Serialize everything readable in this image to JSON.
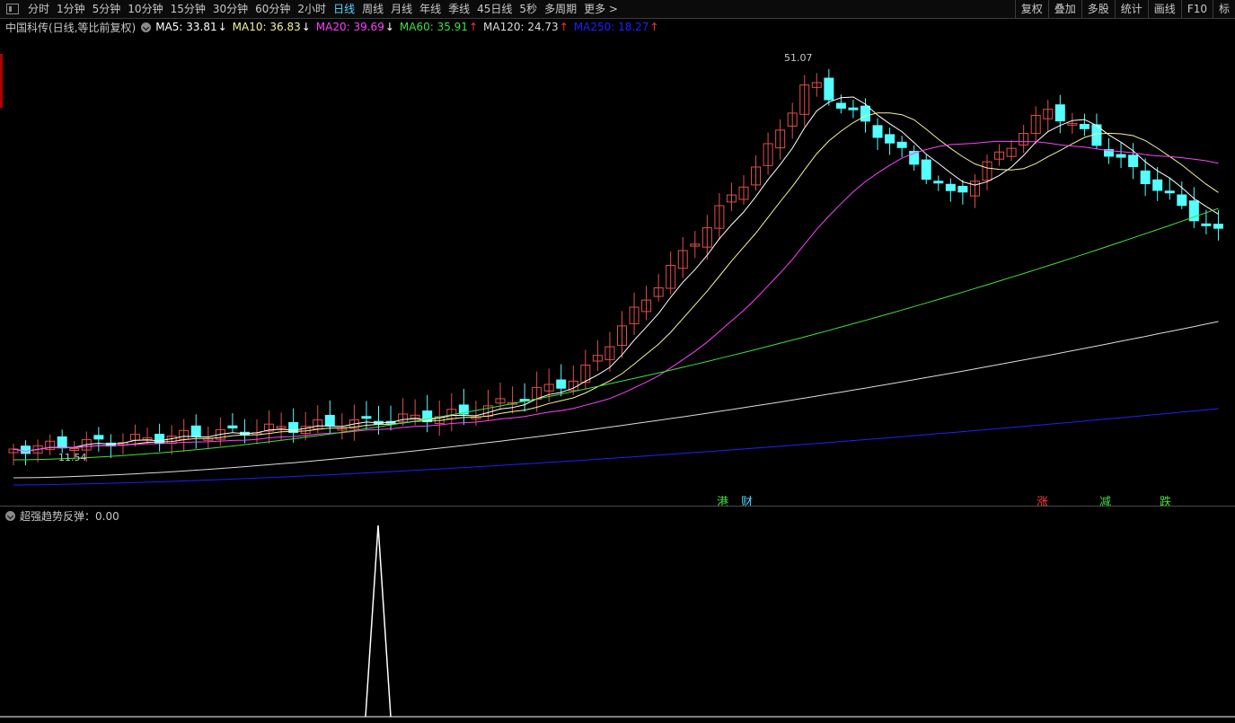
{
  "toolbar": {
    "timeframes": [
      "分时",
      "1分钟",
      "5分钟",
      "10分钟",
      "15分钟",
      "30分钟",
      "60分钟",
      "2小时",
      "日线",
      "周线",
      "月线",
      "年线",
      "季线",
      "45日线",
      "5秒",
      "多周期",
      "更多 >"
    ],
    "active": "日线",
    "right_buttons": [
      "复权",
      "叠加",
      "多股",
      "统计",
      "画线",
      "F10",
      "标"
    ]
  },
  "chart": {
    "title": "中国科传(日线,等比前复权)",
    "ma": [
      {
        "label": "MA5: 33.81",
        "arrow": "↓",
        "color": "#ffffff",
        "arrow_color": "#ffffff"
      },
      {
        "label": "MA10: 36.83",
        "arrow": "↓",
        "color": "#f5f39a",
        "arrow_color": "#ffffff"
      },
      {
        "label": "MA20: 39.69",
        "arrow": "↓",
        "color": "#ff40ff",
        "arrow_color": "#ffffff"
      },
      {
        "label": "MA60: 35.91",
        "arrow": "↑",
        "color": "#40e040",
        "arrow_color": "#ff3030"
      },
      {
        "label": "MA120: 24.73",
        "arrow": "↑",
        "color": "#dcdcdc",
        "arrow_color": "#ff3030"
      },
      {
        "label": "MA250: 18.27",
        "arrow": "↑",
        "color": "#2020ff",
        "arrow_color": "#ff3030"
      }
    ],
    "high_label": "51.07",
    "low_label": "11.54",
    "tags": [
      {
        "text": "港",
        "color": "#40e040"
      },
      {
        "text": "财",
        "color": "#57d7ff"
      },
      {
        "text": "涨",
        "color": "#ff4040"
      },
      {
        "text": "减",
        "color": "#40e040"
      },
      {
        "text": "跌",
        "color": "#40e040"
      }
    ],
    "colors": {
      "up": "#e0504a",
      "down": "#55ffff",
      "bg": "#000000"
    }
  },
  "indicator": {
    "label": "超强趋势反弹：0.00"
  }
}
